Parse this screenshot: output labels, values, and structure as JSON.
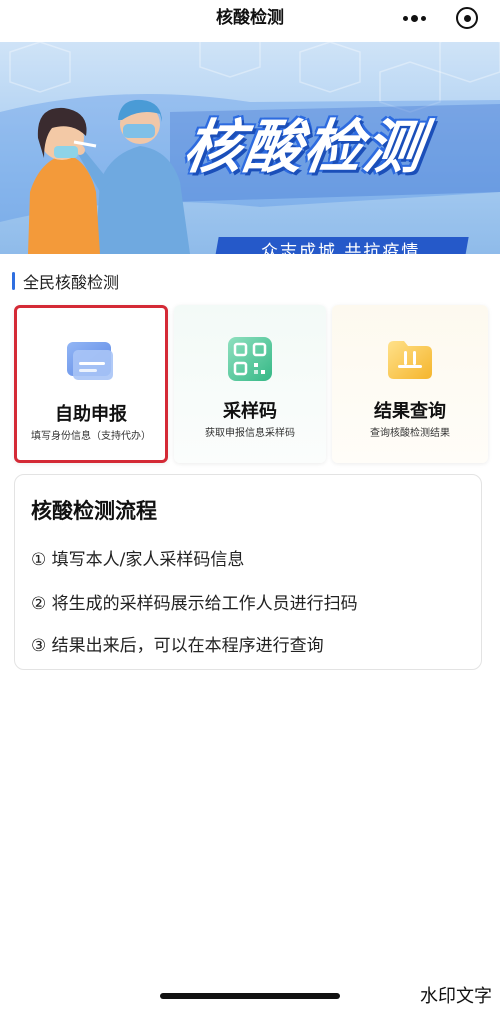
{
  "navbar": {
    "title": "核酸检测",
    "more_icon": "more-dots-icon",
    "close_icon": "close-target-icon"
  },
  "banner": {
    "title": "核酸检测",
    "slogan": "众志成城  共抗疫情",
    "colors": {
      "sky": "#a9cdf1",
      "title_stroke": "#1f57c8",
      "slogan_bg": "#2559c9"
    }
  },
  "section": {
    "label": "全民核酸检测",
    "accent": "#2f6fe0"
  },
  "cards": [
    {
      "title": "自助申报",
      "subtitle": "填写身份信息（支持代办）",
      "icon": "form-report-icon"
    },
    {
      "title": "采样码",
      "subtitle": "获取申报信息采样码",
      "icon": "qr-code-icon"
    },
    {
      "title": "结果查询",
      "subtitle": "查询核酸检测结果",
      "icon": "result-folder-icon"
    }
  ],
  "highlight_color": "#d42a36",
  "process": {
    "title": "核酸检测流程",
    "steps": [
      "① 填写本人/家人采样码信息",
      "② 将生成的采样码展示给工作人员进行扫码",
      "③ 结果出来后，可以在本程序进行查询"
    ]
  },
  "watermark": "水印文字"
}
